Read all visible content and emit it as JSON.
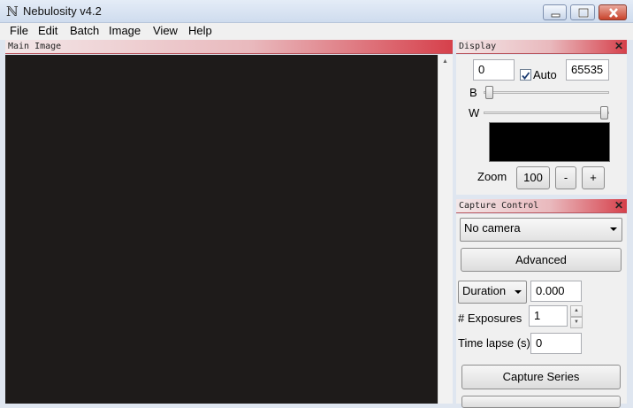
{
  "window": {
    "title": "Nebulosity v4.2",
    "icon": "nebulosity-n-icon"
  },
  "menu": [
    "File",
    "Edit",
    "Batch",
    "Image",
    "View",
    "Help"
  ],
  "main_panel": {
    "title": "Main Image"
  },
  "display_panel": {
    "title": "Display",
    "black_value": "0",
    "auto_label": "Auto",
    "auto_checked": true,
    "white_value": "65535",
    "b_label": "B",
    "w_label": "W",
    "b_slider_level": 0.0,
    "w_slider_level": 1.0,
    "zoom_label": "Zoom",
    "zoom_value": "100",
    "zoom_minus": "-",
    "zoom_plus": "+"
  },
  "capture_panel": {
    "title": "Capture Control",
    "camera_selected": "No camera",
    "advanced_label": "Advanced",
    "duration_selected": "Duration",
    "duration_value": "0.000",
    "exposures_label": "# Exposures",
    "exposures_value": "1",
    "timelapse_label": "Time lapse (s)",
    "timelapse_value": "0",
    "capture_series_label": "Capture Series"
  },
  "colors": {
    "panel_header_accent": "#d6404b",
    "image_background": "#1e1b1a",
    "close_button": "#c9432b"
  }
}
